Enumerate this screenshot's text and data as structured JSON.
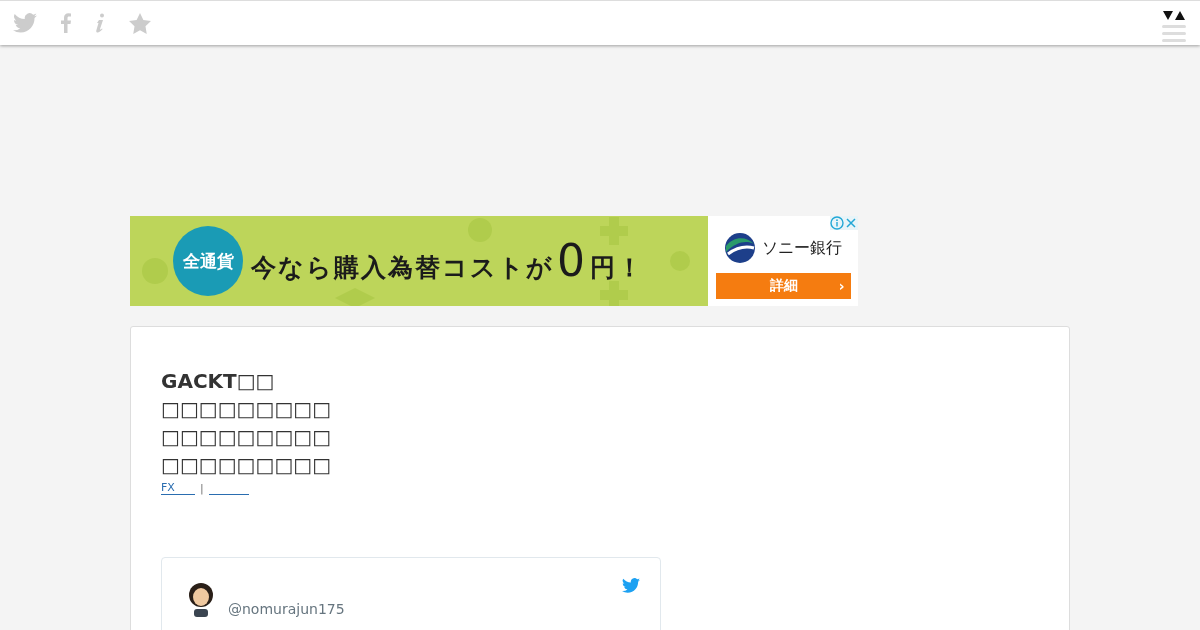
{
  "ad": {
    "badge": "全通貨",
    "headline": "今なら購入為替コストが",
    "big": "0",
    "tail": "円！",
    "brand": "ソニー銀行",
    "cta": "詳細",
    "cta_arrow": "›"
  },
  "article": {
    "title_lines": [
      "GACKT□□",
      "□□□□□□□□□",
      "□□□□□□□□□",
      "□□□□□□□□□"
    ],
    "tags": [
      {
        "kind": "link",
        "label": "FX"
      },
      {
        "kind": "separator",
        "label": "|"
      },
      {
        "kind": "blank-link"
      }
    ]
  },
  "tweet": {
    "handle": "@nomurajun175"
  }
}
